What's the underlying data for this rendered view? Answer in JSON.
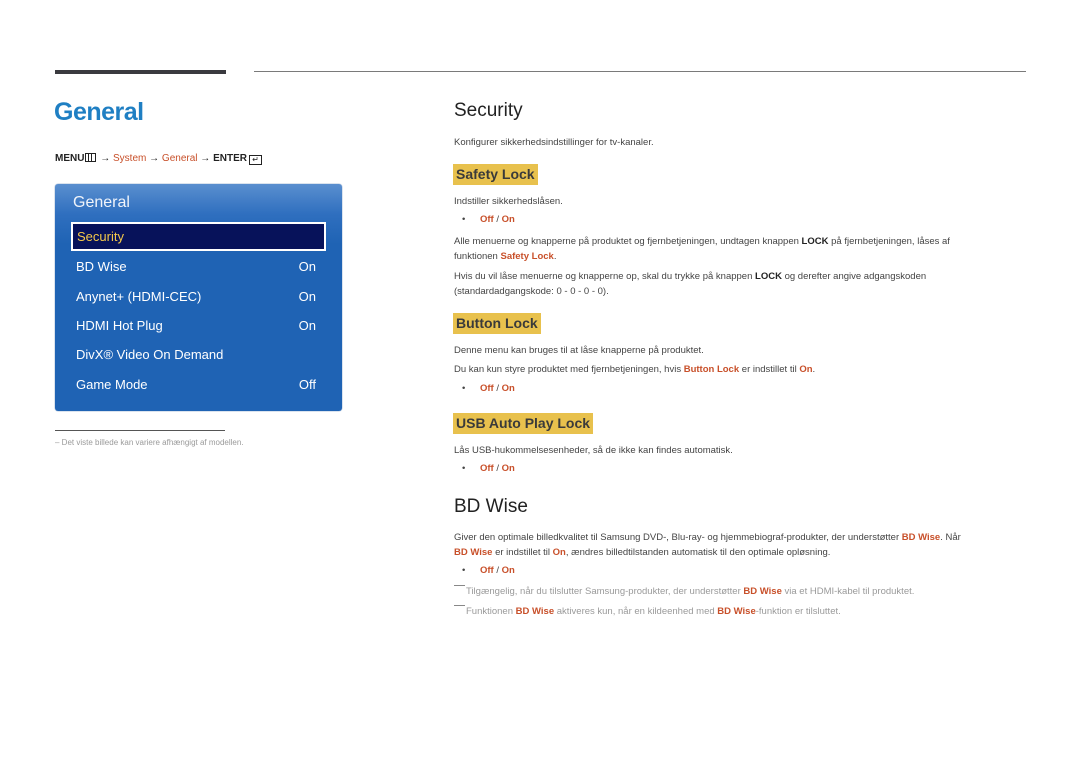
{
  "header": {
    "page_title": "General",
    "breadcrumb": {
      "menu": "MENU",
      "arrow": "→",
      "system": "System",
      "general": "General",
      "enter": "ENTER",
      "enter_glyph": "↵"
    }
  },
  "panel": {
    "title": "General",
    "selected": "Security",
    "items": [
      {
        "label": "BD Wise",
        "value": "On"
      },
      {
        "label": "Anynet+ (HDMI-CEC)",
        "value": "On"
      },
      {
        "label": "HDMI Hot Plug",
        "value": "On"
      },
      {
        "label": "DivX® Video On Demand",
        "value": ""
      },
      {
        "label": "Game Mode",
        "value": "Off"
      }
    ]
  },
  "left_footnote": "Det viste billede kan variere afhængigt af modellen.",
  "security": {
    "title": "Security",
    "description": "Konfigurer sikkerhedsindstillinger for tv-kanaler.",
    "safety_lock": {
      "title": "Safety Lock",
      "desc": "Indstiller sikkerhedslåsen.",
      "off": "Off",
      "sep": " / ",
      "on": "On",
      "p1_a": "Alle menuerne og knapperne på produktet og fjernbetjeningen, undtagen knappen ",
      "p1_lock": "LOCK",
      "p1_b": " på fjernbetjeningen, låses af",
      "p1_c": "funktionen ",
      "p1_ref": "Safety Lock",
      "p1_d": ".",
      "p2_a": "Hvis du vil låse menuerne og knapperne op, skal du trykke på knappen ",
      "p2_lock": "LOCK",
      "p2_b": " og derefter angive adgangskoden",
      "p2_c": "(standardadgangskode: 0 - 0 - 0 - 0)."
    },
    "button_lock": {
      "title": "Button Lock",
      "p1": "Denne menu kan bruges til at låse knapperne på produktet.",
      "p2_a": "Du kan kun styre produktet med fjernbetjeningen, hvis ",
      "p2_ref": "Button Lock",
      "p2_b": " er indstillet til ",
      "p2_on": "On",
      "p2_c": ".",
      "off": "Off",
      "sep": " / ",
      "on": "On"
    },
    "usb_lock": {
      "title": "USB Auto Play Lock",
      "p1": "Lås USB-hukommelsesenheder, så de ikke kan findes automatisk.",
      "off": "Off",
      "sep": " / ",
      "on": "On"
    }
  },
  "bd_wise": {
    "title": "BD Wise",
    "p1_a": "Giver den optimale billedkvalitet til Samsung DVD-, Blu-ray- og hjemmebiograf-produkter, der understøtter ",
    "p1_ref": "BD Wise",
    "p1_b": ". Når",
    "p2_ref": "BD Wise",
    "p2_a": " er indstillet til ",
    "p2_on": "On",
    "p2_b": ", ændres billedtilstanden automatisk til den optimale opløsning.",
    "off": "Off",
    "sep": " / ",
    "on": "On",
    "note1_a": "Tilgængelig, når du tilslutter Samsung-produkter, der understøtter ",
    "note1_ref": "BD Wise",
    "note1_b": " via et HDMI-kabel til produktet.",
    "note2_a": "Funktionen ",
    "note2_ref": "BD Wise",
    "note2_b": " aktiveres kun, når en kildeenhed med ",
    "note2_ref2": "BD Wise",
    "note2_c": "-funktion er tilsluttet."
  },
  "colors": {
    "title_blue": "#1f7fc3",
    "accent_orange": "#c8502a",
    "highlight_yellow": "#e8c14d",
    "panel_blue": "#1f63b4",
    "selected_navy": "#07125a",
    "selected_text": "#f4c84a"
  }
}
